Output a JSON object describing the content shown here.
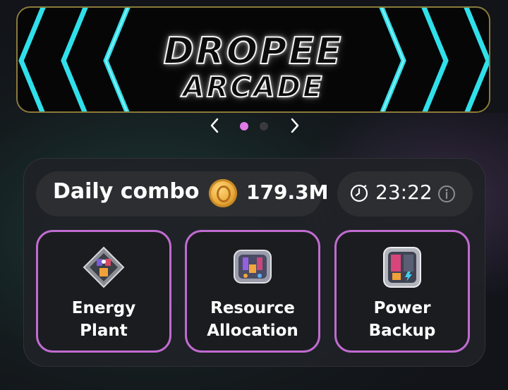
{
  "banner": {
    "title_line1": "DROPEE",
    "title_line2": "ARCADE"
  },
  "carousel": {
    "active_index": 0,
    "total": 2,
    "active_color": "#e07ae8",
    "inactive_color": "#3a3a3e"
  },
  "daily_combo": {
    "label": "Daily combo",
    "amount": "179.3M",
    "coin_icon": "coin-icon",
    "timer": "23:22"
  },
  "cards": [
    {
      "label_line1": "Energy",
      "label_line2": "Plant",
      "icon": "energy-plant-icon"
    },
    {
      "label_line1": "Resource",
      "label_line2": "Allocation",
      "icon": "resource-allocation-icon"
    },
    {
      "label_line1": "Power",
      "label_line2": "Backup",
      "icon": "power-backup-icon"
    }
  ],
  "colors": {
    "card_border": "#c06bd0",
    "banner_chevron": "#2fe0ea",
    "banner_border": "#8a7a3a"
  }
}
